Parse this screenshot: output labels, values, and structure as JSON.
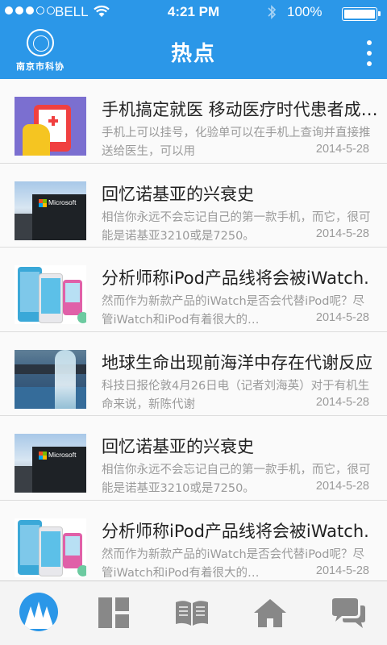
{
  "status_bar": {
    "carrier": "BELL",
    "time": "4:21 PM",
    "battery": "100%",
    "signal_bars_filled": 3,
    "signal_bars_total": 5
  },
  "header": {
    "logo_text": "南京市科协",
    "title": "热点",
    "accent_color": "#2b97e8"
  },
  "news": [
    {
      "title": "手机搞定就医 移动医疗时代患者成…",
      "summary": "手机上可以挂号，化验单可以在手机上查询并直接推送给医生，可以用",
      "date": "2014-5-28",
      "thumb": "medical-app-image"
    },
    {
      "title": "回忆诺基亚的兴衰史",
      "summary": "相信你永远不会忘记自己的第一款手机，而它，很可能是诺基亚3210或是7250。",
      "date": "2014-5-28",
      "thumb": "microsoft-building-image"
    },
    {
      "title": "分析师称iPod产品线将会被iWatch.",
      "summary": "然而作为新款产品的iWatch是否会代替iPod呢？尽管iWatch和iPod有着很大的…",
      "date": "2014-5-28",
      "thumb": "ipod-lineup-image"
    },
    {
      "title": "地球生命出现前海洋中存在代谢反应",
      "summary": "科技日报伦敦4月26日电（记者刘海英）对于有机生命来说，新陈代谢",
      "date": "2014-5-28",
      "thumb": "ocean-image"
    },
    {
      "title": "回忆诺基亚的兴衰史",
      "summary": "相信你永远不会忘记自己的第一款手机，而它，很可能是诺基亚3210或是7250。",
      "date": "2014-5-28",
      "thumb": "microsoft-building-image"
    },
    {
      "title": "分析师称iPod产品线将会被iWatch.",
      "summary": "然而作为新款产品的iWatch是否会代替iPod呢？尽管iWatch和iPod有着很大的…",
      "date": "2014-5-28",
      "thumb": "ipod-lineup-image"
    }
  ],
  "thumb_ms_text": "Microsoft",
  "tabbar": {
    "items": [
      "hotspot-mountain-icon",
      "grid-icon",
      "book-icon",
      "home-icon",
      "chat-icon"
    ],
    "active_index": 0
  }
}
